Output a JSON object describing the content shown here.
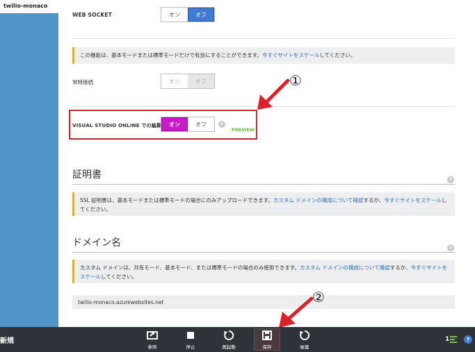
{
  "sidebar": {
    "site_name": "twilio-monaco"
  },
  "websocket": {
    "label": "WEB SOCKET",
    "on": "オン",
    "off": "オフ",
    "selected": "off"
  },
  "notice_mode": {
    "text": "この機能は、基本モードまたは標準モードだけで有効にすることができます。",
    "link": "今すぐサイトをスケール",
    "suffix": "してください。"
  },
  "always_on": {
    "label": "常時接続",
    "on": "オン",
    "off": "オフ",
    "selected": "off",
    "disabled": true
  },
  "vso": {
    "label": "VISUAL STUDIO ONLINE での編集",
    "on": "オン",
    "off": "オフ",
    "selected": "on",
    "badge": "PREVIEW"
  },
  "annotations": {
    "marker1": "①",
    "marker2": "②"
  },
  "certificates": {
    "title": "証明書",
    "note_text": "SSL 証明書は、基本モードまたは標準モードの場合にのみアップロードできます。",
    "link1": "カスタム ドメインの構成について確認",
    "mid": "するか、",
    "link2": "今すぐサイトをスケール",
    "suffix": "してください。"
  },
  "domains": {
    "title": "ドメイン名",
    "note_text": "カスタム ドメインは、共有モード、基本モード、または標準モードの場合のみ使用できます。",
    "link1": "カスタム ドメインの構成について確認",
    "mid": "するか、",
    "link2": "今すぐサイトをスケール",
    "suffix": "してください。",
    "hostname": "twilio-monaco.azurewebsites.net"
  },
  "bottombar": {
    "new_label": "新規",
    "commands": [
      {
        "label": "参照",
        "icon": "browse-icon"
      },
      {
        "label": "停止",
        "icon": "stop-icon"
      },
      {
        "label": "再起動",
        "icon": "restart-icon"
      },
      {
        "label": "保存",
        "icon": "save-icon"
      },
      {
        "label": "破棄",
        "icon": "discard-icon"
      }
    ],
    "count": "1"
  },
  "colors": {
    "sidebar": "#4f95c7",
    "toggle_on": "#3e7ad1",
    "vso_on": "#c81bc8",
    "annotation_red": "#d8232a",
    "preview_green": "#6cbd3c",
    "link": "#2f6bb5",
    "bottombar": "#2d3338"
  }
}
